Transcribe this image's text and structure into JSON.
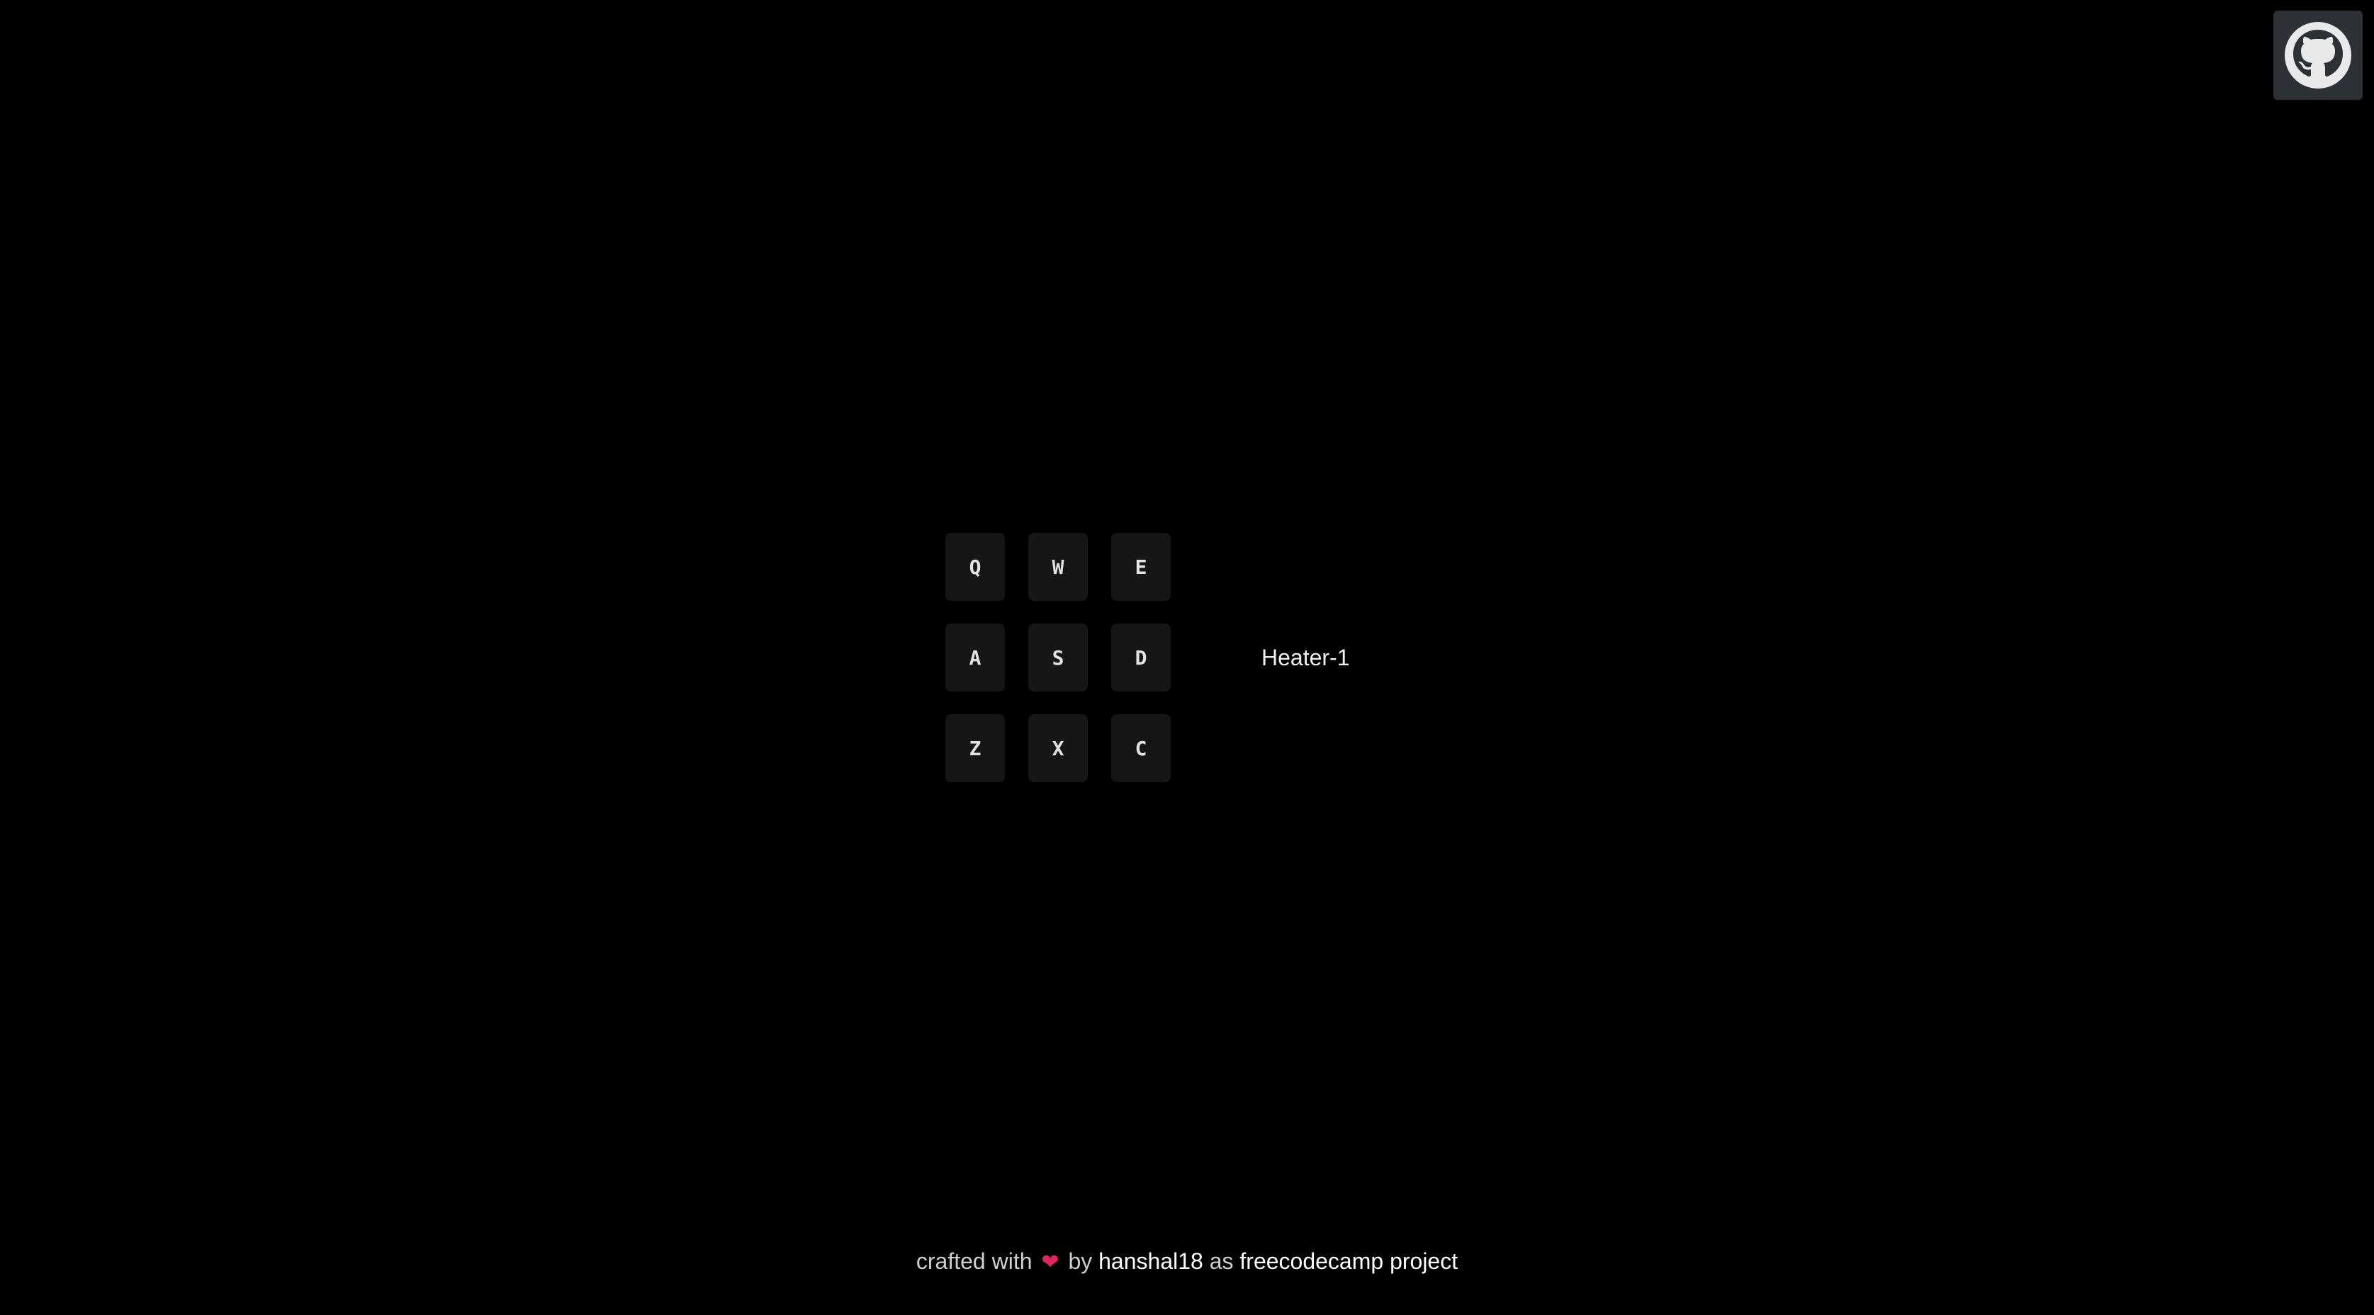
{
  "github": {
    "icon": "github-octocat-icon",
    "background": "#2d3136"
  },
  "drum_pads": [
    {
      "key": "Q"
    },
    {
      "key": "W"
    },
    {
      "key": "E"
    },
    {
      "key": "A"
    },
    {
      "key": "S"
    },
    {
      "key": "D"
    },
    {
      "key": "Z"
    },
    {
      "key": "X"
    },
    {
      "key": "C"
    }
  ],
  "display": {
    "text": "Heater-1"
  },
  "footer": {
    "prefix": "crafted with",
    "heart": "❤",
    "by": "by",
    "author": "hanshal18",
    "as": "as",
    "project": "freecodecamp project"
  },
  "colors": {
    "background": "#000000",
    "pad": "#161616",
    "heart": "#e0245e"
  }
}
